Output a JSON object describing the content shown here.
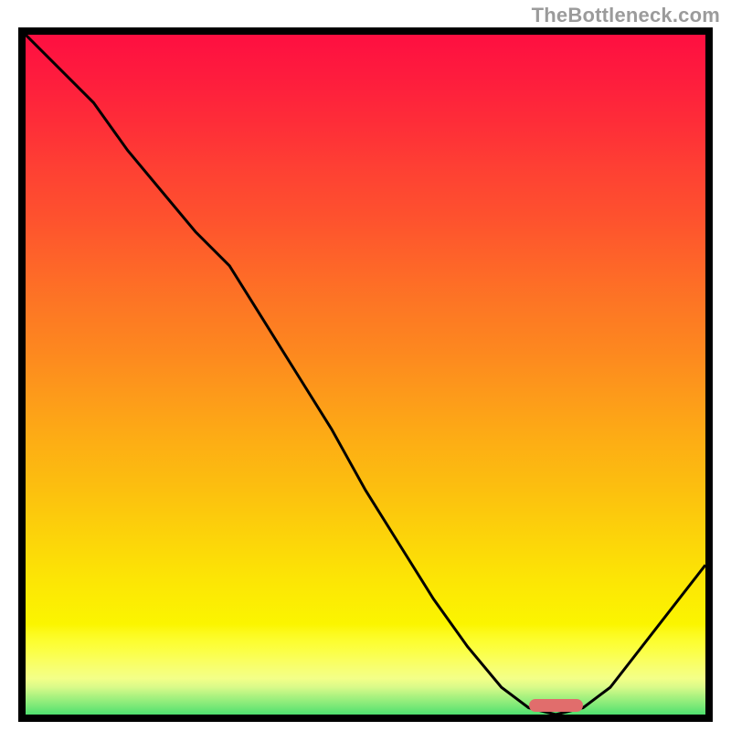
{
  "watermark": "TheBottleneck.com",
  "chart_data": {
    "type": "line",
    "title": "",
    "xlabel": "",
    "ylabel": "",
    "xlim": [
      0,
      100
    ],
    "ylim": [
      0,
      100
    ],
    "x": [
      0,
      5,
      10,
      15,
      20,
      25,
      28,
      30,
      35,
      40,
      45,
      50,
      55,
      60,
      65,
      70,
      74,
      78,
      82,
      86,
      100
    ],
    "y_curve": [
      100,
      95,
      90,
      83,
      77,
      71,
      68,
      66,
      58,
      50,
      42,
      33,
      25,
      17,
      10,
      4,
      1,
      0,
      1,
      4,
      22
    ],
    "highlight_range_x": [
      74,
      82
    ],
    "gradient_stops": [
      {
        "pct": 0.0,
        "color": "#fe0f41"
      },
      {
        "pct": 0.067,
        "color": "#fe1d3d"
      },
      {
        "pct": 0.133,
        "color": "#fe2e38"
      },
      {
        "pct": 0.2,
        "color": "#fe4133"
      },
      {
        "pct": 0.267,
        "color": "#fe512e"
      },
      {
        "pct": 0.333,
        "color": "#fe6429"
      },
      {
        "pct": 0.4,
        "color": "#fd7724"
      },
      {
        "pct": 0.467,
        "color": "#fd881f"
      },
      {
        "pct": 0.533,
        "color": "#fd9b1a"
      },
      {
        "pct": 0.6,
        "color": "#fdae14"
      },
      {
        "pct": 0.667,
        "color": "#fcbf0f"
      },
      {
        "pct": 0.733,
        "color": "#fcd20a"
      },
      {
        "pct": 0.8,
        "color": "#fce505"
      },
      {
        "pct": 0.867,
        "color": "#fbf500"
      },
      {
        "pct": 0.88,
        "color": "#fcfa1d"
      },
      {
        "pct": 0.893,
        "color": "#fcfe32"
      },
      {
        "pct": 0.907,
        "color": "#fbff47"
      },
      {
        "pct": 0.92,
        "color": "#faff5e"
      },
      {
        "pct": 0.933,
        "color": "#f7ff74"
      },
      {
        "pct": 0.947,
        "color": "#f3ff88"
      },
      {
        "pct": 0.96,
        "color": "#d8fa89"
      },
      {
        "pct": 0.973,
        "color": "#abf280"
      },
      {
        "pct": 0.987,
        "color": "#7de978"
      },
      {
        "pct": 1.0,
        "color": "#4fe06f"
      }
    ],
    "highlight_color": "#e16d6c",
    "curve_color": "#000000",
    "curve_width": 3
  }
}
